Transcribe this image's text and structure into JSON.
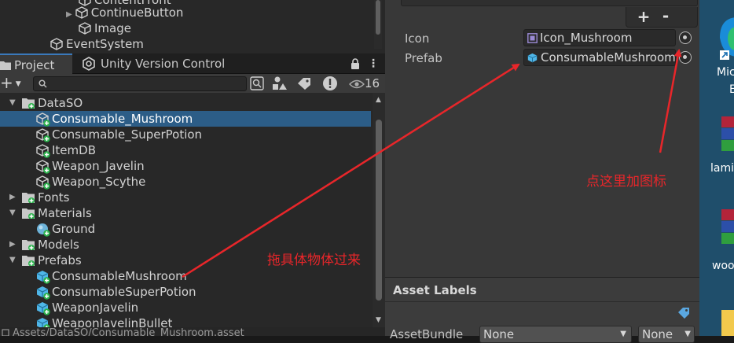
{
  "hierarchy": {
    "items": [
      {
        "label": "ContentFront"
      },
      {
        "label": "ContinueButton"
      },
      {
        "label": "Image"
      },
      {
        "label": "EventSystem"
      }
    ]
  },
  "tabs": {
    "project": "Project",
    "version_control": "Unity Version Control"
  },
  "toolbar": {
    "add": "+",
    "search_placeholder": "",
    "hidden_count": "16"
  },
  "project": {
    "items": [
      {
        "label": "DataSO"
      },
      {
        "label": "Consumable_Mushroom"
      },
      {
        "label": "Consumable_SuperPotion"
      },
      {
        "label": "ItemDB"
      },
      {
        "label": "Weapon_Javelin"
      },
      {
        "label": "Weapon_Scythe"
      },
      {
        "label": "Fonts"
      },
      {
        "label": "Materials"
      },
      {
        "label": "Ground"
      },
      {
        "label": "Models"
      },
      {
        "label": "Prefabs"
      },
      {
        "label": "ConsumableMushroom"
      },
      {
        "label": "ConsumableSuperPotion"
      },
      {
        "label": "WeaponJavelin"
      },
      {
        "label": "WeaponJavelinBullet"
      }
    ],
    "status_path": "Assets/DataSO/Consumable_Mushroom.asset"
  },
  "inspector": {
    "add_label": "+",
    "remove_label": "-",
    "icon_label": "Icon",
    "icon_value": "Icon_Mushroom",
    "prefab_label": "Prefab",
    "prefab_value": "ConsumableMushroom",
    "asset_labels_title": "Asset Labels",
    "assetbundle_label": "AssetBundle",
    "assetbundle_value": "None",
    "variant_value": "None"
  },
  "annotations": {
    "icon_note": "点这里加图标",
    "drag_note": "拖具体物体过来"
  },
  "desktop": {
    "items": [
      {
        "label": "Micr"
      },
      {
        "label": "E"
      },
      {
        "label": "lami"
      },
      {
        "label": "woo"
      }
    ]
  },
  "colors": {
    "annotation_red": "#e8262a",
    "selection_blue": "#2c5d87",
    "badge_green": "#2bb24c"
  }
}
